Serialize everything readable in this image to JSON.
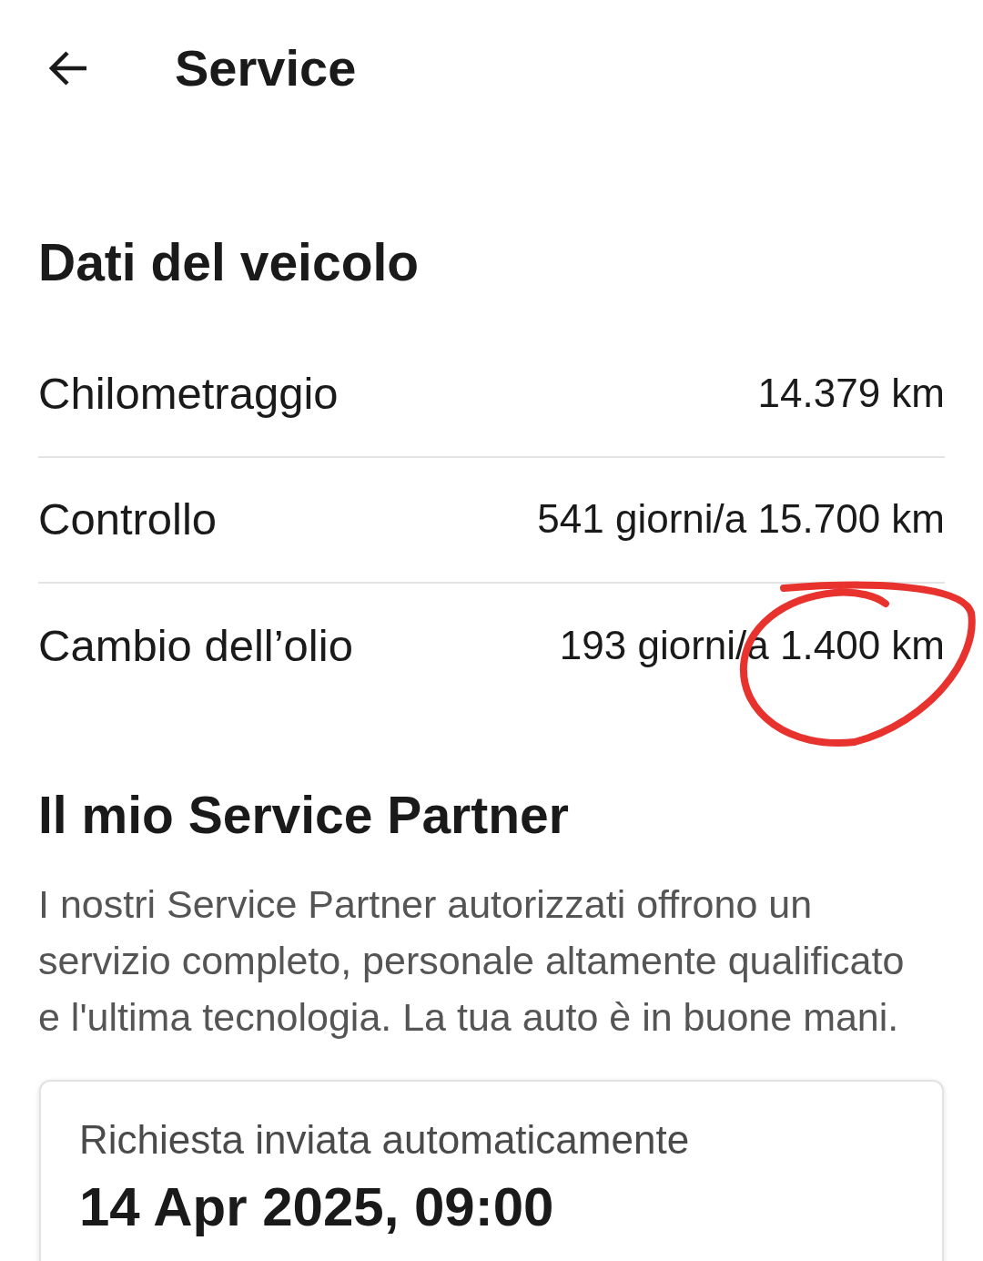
{
  "header": {
    "title": "Service"
  },
  "vehicle_data": {
    "heading": "Dati del veicolo",
    "rows": [
      {
        "label": "Chilometraggio",
        "value": "14.379 km",
        "circled": false
      },
      {
        "label": "Controllo",
        "value": "541 giorni/a 15.700 km",
        "circled": false
      },
      {
        "label": "Cambio dell’olio",
        "value": "193 giorni/a 1.400 km",
        "circled": true
      }
    ]
  },
  "service_partner": {
    "heading": "Il mio Service Partner",
    "description": "I nostri Service Partner autorizzati offrono un servizio completo, personale altamente qualificato e l'ultima tecnologia. La tua auto è in buone mani.",
    "card": {
      "label": "Richiesta inviata automaticamente",
      "date": "14 Apr 2025, 09:00"
    }
  }
}
